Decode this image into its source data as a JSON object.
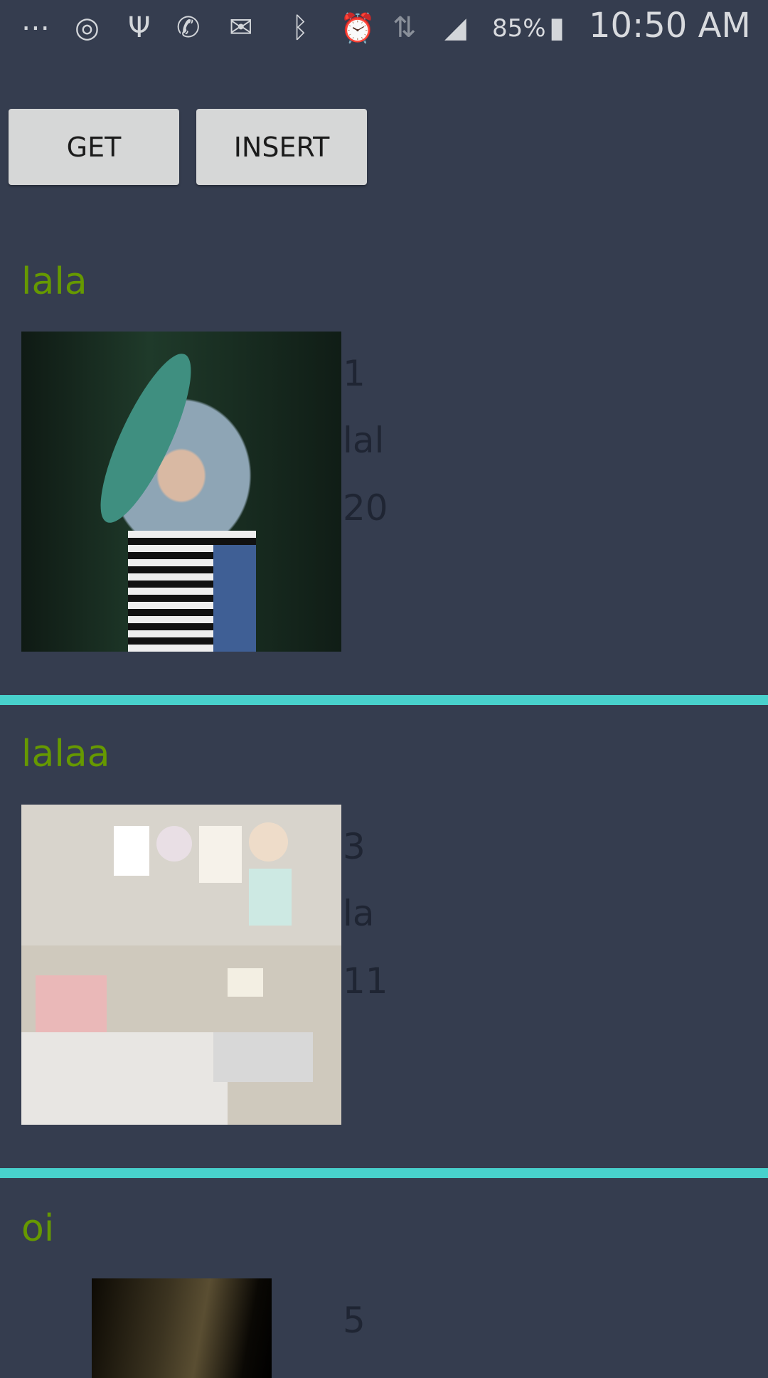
{
  "status_bar": {
    "icons": [
      "more-notifications-icon",
      "instagram-icon",
      "usb-icon",
      "whatsapp-icon",
      "email-icon",
      "bluetooth-icon",
      "alarm-icon",
      "wifi-icon",
      "signal-icon",
      "battery-charging-icon"
    ],
    "battery": "85%",
    "time": "10:50 AM"
  },
  "toolbar": {
    "get_label": "GET",
    "insert_label": "INSERT"
  },
  "colors": {
    "background": "#353d4f",
    "title": "#669900",
    "separator": "#48d1cc",
    "button": "#d6d7d7"
  },
  "items": [
    {
      "title": "lala",
      "id": "1",
      "name": "lal",
      "age": "20",
      "image": "woman-with-leaf-photo"
    },
    {
      "title": "lalaa",
      "id": "3",
      "name": "la",
      "age": "11",
      "image": "bedroom-interior-photo"
    },
    {
      "title": "oi",
      "id": "5",
      "image": "dark-lamp-photo"
    }
  ]
}
